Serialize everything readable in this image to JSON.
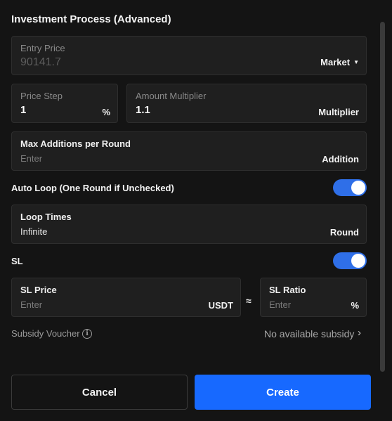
{
  "title": "Investment Process (Advanced)",
  "entry_price": {
    "label": "Entry Price",
    "value": "90141.7",
    "type_select": "Market"
  },
  "price_step": {
    "label": "Price Step",
    "value": "1",
    "unit": "%"
  },
  "amount_multiplier": {
    "label": "Amount Multiplier",
    "value": "1.1",
    "unit": "Multiplier"
  },
  "max_additions": {
    "label": "Max Additions per Round",
    "placeholder": "Enter",
    "unit": "Addition"
  },
  "auto_loop": {
    "label": "Auto Loop (One Round if Unchecked)",
    "enabled": true
  },
  "loop_times": {
    "label": "Loop Times",
    "value": "Infinite",
    "unit": "Round"
  },
  "sl": {
    "label": "SL",
    "enabled": true
  },
  "sl_price": {
    "label": "SL Price",
    "placeholder": "Enter",
    "unit": "USDT"
  },
  "approx_symbol": "≈",
  "sl_ratio": {
    "label": "SL Ratio",
    "placeholder": "Enter",
    "unit": "%"
  },
  "subsidy": {
    "label": "Subsidy Voucher",
    "info_icon": "i",
    "value": "No available subsidy",
    "chevron": "›"
  },
  "buttons": {
    "cancel": "Cancel",
    "create": "Create"
  },
  "colors": {
    "accent": "#1769ff",
    "toggle": "#2f6fe8",
    "background": "#141414",
    "field": "#1f1f1f"
  }
}
